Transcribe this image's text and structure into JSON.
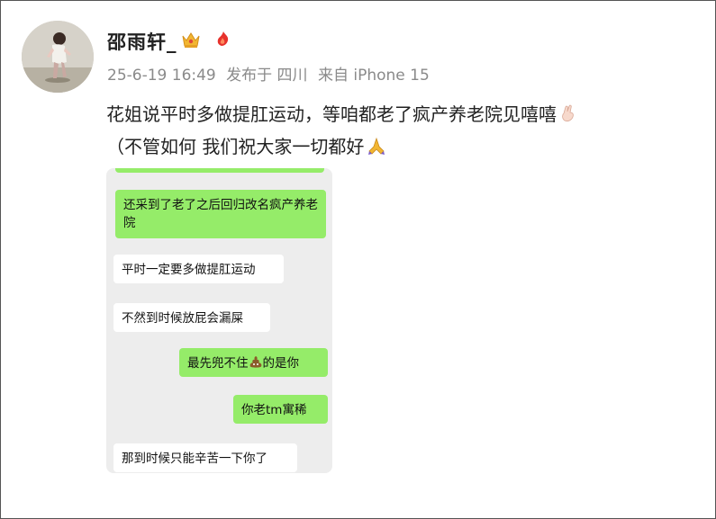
{
  "post": {
    "username": "邵雨轩_",
    "meta": {
      "time": "25-6-19 16:49",
      "location": "发布于 四川",
      "device": "来自 iPhone 15"
    },
    "text_line1": "花姐说平时多做提肛运动，等咱都老了疯产养老院见嘻嘻",
    "text_line2": "（不管如何 我们祝大家一切都好",
    "icons": {
      "avatar": "avatar-photo",
      "badge1": "crown-icon",
      "badge2": "fire-icon",
      "emoji1": "crossed-fingers-icon",
      "emoji2": "folded-hands-icon"
    }
  },
  "chat": {
    "messages": [
      {
        "side": "right",
        "text": "还采到了老了之后回归改名疯产养老院"
      },
      {
        "side": "left",
        "text": "平时一定要多做提肛运动"
      },
      {
        "side": "left",
        "text": "不然到时候放屁会漏屎"
      },
      {
        "side": "right",
        "text_before": "最先兜不住",
        "emoji": "poop-icon",
        "text_after": "的是你"
      },
      {
        "side": "right",
        "text": "你老tm寓稀"
      },
      {
        "side": "left",
        "text": "那到时候只能辛苦一下你了"
      }
    ]
  },
  "colors": {
    "meta_gray": "#8a8a8a",
    "bubble_green": "#95ec69",
    "chat_bg": "#ededed"
  }
}
